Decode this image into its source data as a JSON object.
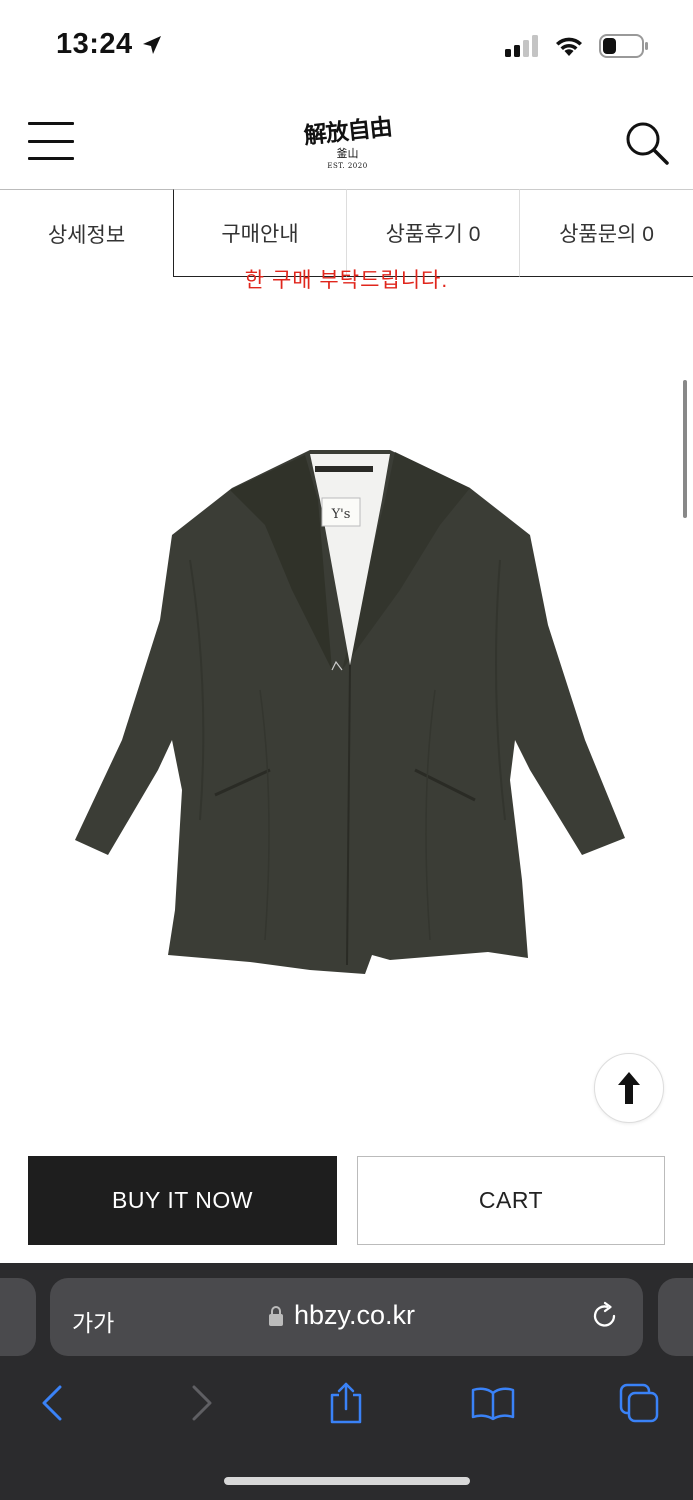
{
  "status_bar": {
    "time": "13:24",
    "location_icon": "location-arrow-icon",
    "signal_icon": "cellular-signal-icon",
    "wifi_icon": "wifi-icon",
    "battery_icon": "battery-icon"
  },
  "header": {
    "menu_icon": "hamburger-menu-icon",
    "logo_main": "解放自由",
    "logo_sub": "釜山",
    "logo_est": "EST. 2020",
    "search_icon": "search-icon"
  },
  "tabs": [
    {
      "label": "상세정보",
      "active": true
    },
    {
      "label": "구매안내",
      "active": false
    },
    {
      "label": "상품후기 0",
      "active": false
    },
    {
      "label": "상품문의 0",
      "active": false
    }
  ],
  "notice_text": "한 구매 부탁드립니다.",
  "product": {
    "image_icon": "jacket-product-image",
    "label_text": "Y's"
  },
  "scroll_top_icon": "arrow-up-icon",
  "actions": {
    "buy_label": "BUY IT NOW",
    "cart_label": "CART"
  },
  "browser": {
    "text_size_label": "가가",
    "url": "hbzy.co.kr",
    "lock_icon": "lock-icon",
    "reload_icon": "reload-icon",
    "back_icon": "back-chevron-icon",
    "forward_icon": "forward-chevron-icon",
    "share_icon": "share-icon",
    "bookmarks_icon": "bookmarks-icon",
    "tabs_icon": "tabs-icon"
  },
  "colors": {
    "notice_red": "#e0261c",
    "buy_bg": "#1e1e1e",
    "toolbar_bg": "#2b2b2d",
    "browser_blue": "#3a82f7"
  }
}
